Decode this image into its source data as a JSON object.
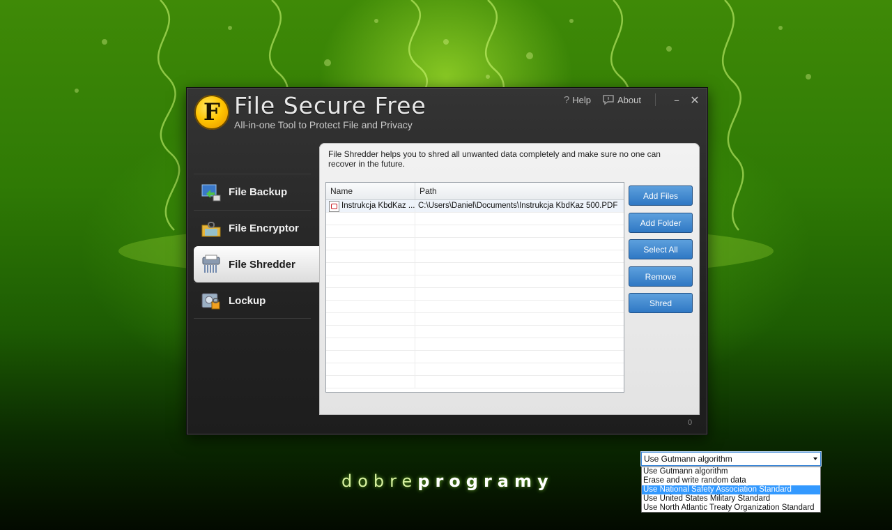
{
  "app": {
    "logo_letter": "F",
    "title": "File Secure Free",
    "subtitle": "All-in-one Tool to Protect File and Privacy"
  },
  "topbar": {
    "help_label": "Help",
    "about_label": "About"
  },
  "nav": {
    "items": [
      {
        "label": "File Backup",
        "icon": "backup-icon"
      },
      {
        "label": "File Encryptor",
        "icon": "encryptor-folder-lock-icon"
      },
      {
        "label": "File Shredder",
        "icon": "shredder-icon",
        "active": true
      },
      {
        "label": "Lockup",
        "icon": "lockup-icon"
      }
    ]
  },
  "panel": {
    "description": "File Shredder helps you to shred all unwanted data completely and make sure no one can recover in the future.",
    "table": {
      "headers": {
        "name": "Name",
        "path": "Path"
      },
      "rows": [
        {
          "name": "Instrukcja KbdKaz ...",
          "path": "C:\\Users\\Daniel\\Documents\\Instrukcja KbdKaz 500.PDF",
          "icon": "pdf-file-icon"
        }
      ]
    },
    "buttons": {
      "add_files": "Add Files",
      "add_folder": "Add Folder",
      "select_all": "Select All",
      "remove": "Remove",
      "shred": "Shred"
    },
    "algorithm": {
      "selected": "Use Gutmann algorithm",
      "options": [
        "Use Gutmann algorithm",
        "Erase and write random data",
        "Use National Safety Association Standard",
        "Use United States Military Standard",
        "Use North Atlantic Treaty Organization Standard"
      ],
      "highlighted_index": 2
    }
  },
  "version_fragment": "0",
  "watermark": {
    "light": "dobre",
    "bold": "programy"
  },
  "colors": {
    "accent_button": "#2f78c4",
    "dropdown_highlight": "#3399ff",
    "logo_gold": "#ffc400",
    "background_green": "#2f7a05"
  }
}
